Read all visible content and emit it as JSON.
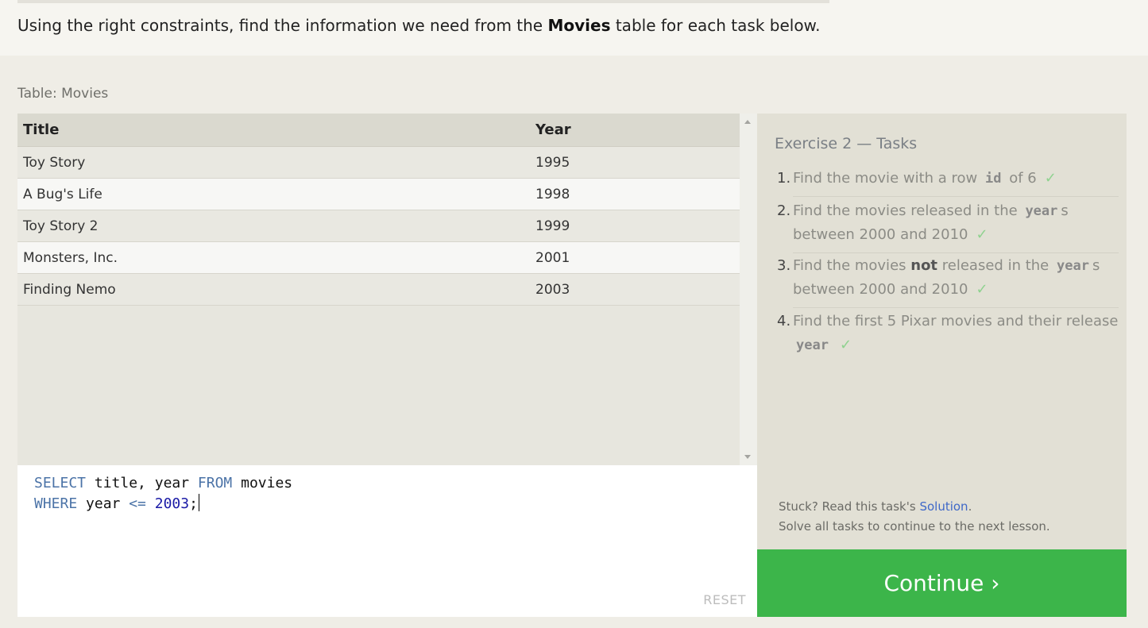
{
  "intro": {
    "prefix": "Using the right constraints, find the information we need from the ",
    "table_name": "Movies",
    "suffix": " table for each task below."
  },
  "table": {
    "caption": "Table: Movies",
    "columns": [
      "Title",
      "Year"
    ],
    "rows": [
      {
        "title": "Toy Story",
        "year": "1995"
      },
      {
        "title": "A Bug's Life",
        "year": "1998"
      },
      {
        "title": "Toy Story 2",
        "year": "1999"
      },
      {
        "title": "Monsters, Inc.",
        "year": "2001"
      },
      {
        "title": "Finding Nemo",
        "year": "2003"
      }
    ]
  },
  "editor": {
    "line1": {
      "kw1": "SELECT",
      "text1": " title, year ",
      "kw2": "FROM",
      "text2": " movies"
    },
    "line2": {
      "kw1": "WHERE",
      "text1": " year ",
      "op": "<=",
      "sp": " ",
      "num": "2003",
      "end": ";"
    },
    "reset_label": "RESET"
  },
  "tasks": {
    "title": "Exercise 2 — Tasks",
    "items": [
      {
        "num": "1.",
        "a": "Find the movie with a row",
        "code": "id",
        "b": "of 6",
        "check": "✓"
      },
      {
        "num": "2.",
        "a": "Find the movies released in the",
        "code": "year",
        "b": "s between 2000 and 2010",
        "check": "✓"
      },
      {
        "num": "3.",
        "a": "Find the movies",
        "bold": "not",
        "a2": "released in the",
        "code": "year",
        "b": "s between 2000 and 2010",
        "check": "✓"
      },
      {
        "num": "4.",
        "a": "Find the first 5 Pixar movies and their release",
        "code": "year",
        "check": "✓"
      }
    ],
    "stuck_prefix": "Stuck? Read this task's ",
    "solution_link": "Solution",
    "stuck_suffix": ".",
    "solve_all": "Solve all tasks to continue to the next lesson."
  },
  "continue_label": "Continue ›",
  "colors": {
    "accent_green": "#3cb54a",
    "keyword_blue": "#4b73a7",
    "link_blue": "#3f68c8",
    "check_green": "#8fd28f"
  }
}
